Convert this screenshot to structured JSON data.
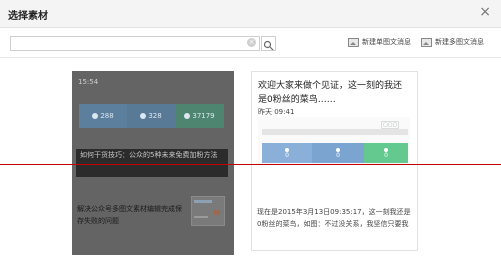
{
  "dialog": {
    "title": "选择素材",
    "close_glyph": "×"
  },
  "toolbar": {
    "search_placeholder": "",
    "new_single_label": "新建单图文消息",
    "new_multi_label": "新建多图文消息"
  },
  "left_card": {
    "time": "15:54",
    "stats": [
      "288",
      "328",
      "37179"
    ],
    "promo_text": "如何干货技巧：公众的5种未来免费加粉方法",
    "bottom_text": "解决公众号多图文素材编辑完成保存失败的问题"
  },
  "right_card": {
    "title": "欢迎大家来做个见证，这一刻的我还是0粉丝的菜鸟……",
    "time": "昨天 09:41",
    "badge": "▢▢▢",
    "stats": [
      "0",
      "0",
      "0"
    ],
    "body": "现在是2015年3月13日09:35:17，这一刻我还是0粉丝的菜鸟，如图：不过没关系，我坚信只要我"
  },
  "colors": {
    "accent_red_line": "#c00000",
    "overlay": "#646464"
  }
}
